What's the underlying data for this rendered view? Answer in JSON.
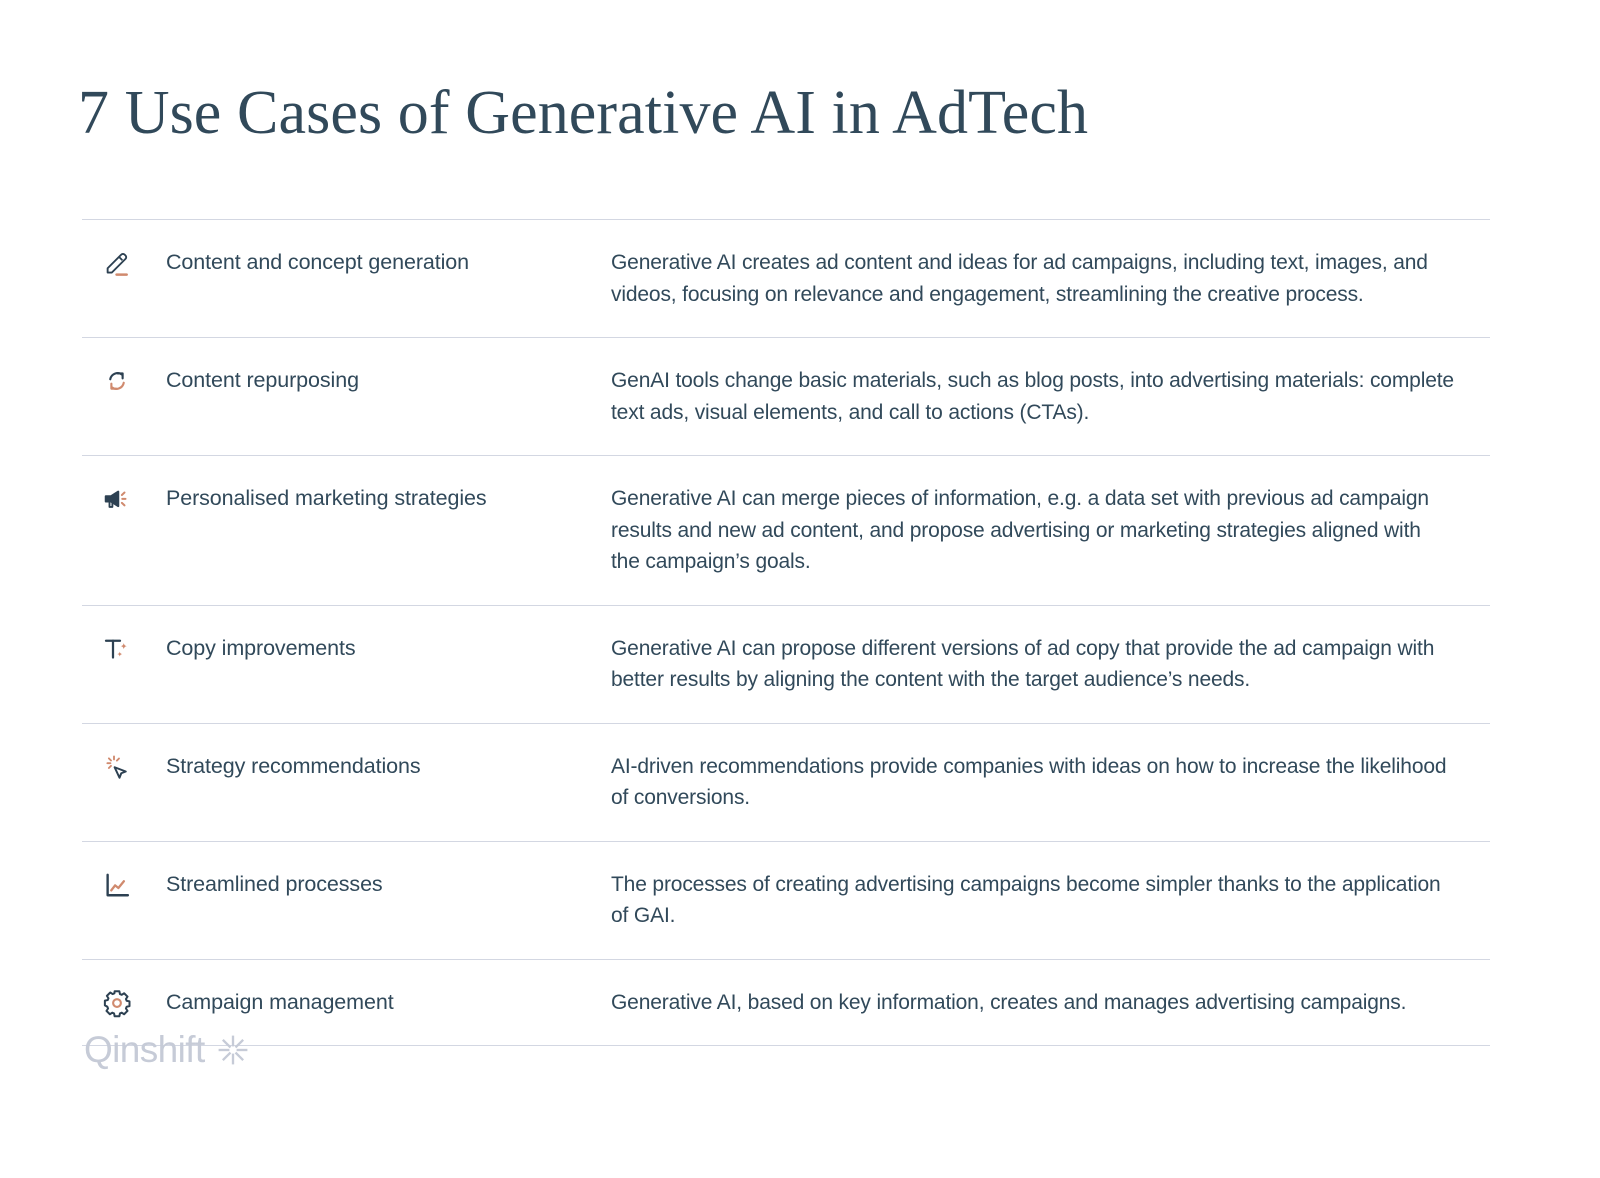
{
  "slide": {
    "title": "7 Use Cases of Generative AI in AdTech",
    "background_color": "#ffffff",
    "text_color": "#31495a",
    "accent_color": "#d08a6e",
    "divider_color": "#d3d7e2",
    "logo_color": "#c6cbd7"
  },
  "rows": [
    {
      "icon": "pencil-icon",
      "label": "Content and concept generation",
      "description": "Generative AI creates ad content and ideas for ad campaigns, including text, images, and videos, focusing on relevance and engagement, streamlining the creative process.",
      "description_lines": [
        "Generative AI creates ad content and ideas for ad campaigns, including text, images, and",
        "videos, focusing on relevance and engagement, streamlining the creative process."
      ]
    },
    {
      "icon": "repurpose-arrows-icon",
      "label": "Content repurposing",
      "description": "GenAI tools change basic materials, such as blog posts, into advertising materials: complete text ads, visual elements, and call to actions (CTAs).",
      "description_lines": [
        "GenAI tools change basic materials, such as blog posts, into advertising materials: complete",
        "text ads, visual elements, and call to actions (CTAs)."
      ]
    },
    {
      "icon": "megaphone-icon",
      "label": "Personalised marketing strategies",
      "description": "Generative AI can merge pieces of information, e.g. a data set with previous ad campaign results and new ad content, and propose advertising or marketing strategies aligned with the campaign’s goals.",
      "description_lines": [
        "Generative AI can merge pieces of information, e.g. a data set with previous ad campaign",
        "results and new ad content, and propose advertising or marketing strategies aligned with",
        "the campaign’s goals."
      ]
    },
    {
      "icon": "text-sparkle-icon",
      "label": "Copy improvements",
      "description": "Generative AI can propose different versions of ad copy that provide the ad campaign with better results by aligning the content with the target audience’s needs.",
      "description_lines": [
        "Generative AI can propose different versions of ad copy that provide the ad campaign with",
        "better results by aligning the content with the target audience’s needs."
      ]
    },
    {
      "icon": "cursor-sparkle-icon",
      "label": "Strategy recommendations",
      "description": "AI-driven recommendations provide companies with ideas on how to increase the likelihood of conversions.",
      "description_lines": [
        "AI-driven recommendations provide companies with ideas on how to increase the likelihood",
        "of conversions."
      ]
    },
    {
      "icon": "line-chart-icon",
      "label": "Streamlined processes",
      "description": "The processes of creating advertising campaigns become simpler thanks to the application of GAI.",
      "description_lines": [
        "The processes of creating advertising campaigns become simpler thanks to the application",
        "of GAI."
      ]
    },
    {
      "icon": "gear-icon",
      "label": "Campaign management",
      "description": "Generative AI, based on key information, creates and manages advertising campaigns.",
      "description_lines": [
        "Generative AI, based on key information, creates and manages advertising campaigns."
      ]
    }
  ],
  "logo": {
    "name": "Qinshift",
    "mark": "starburst-icon"
  }
}
